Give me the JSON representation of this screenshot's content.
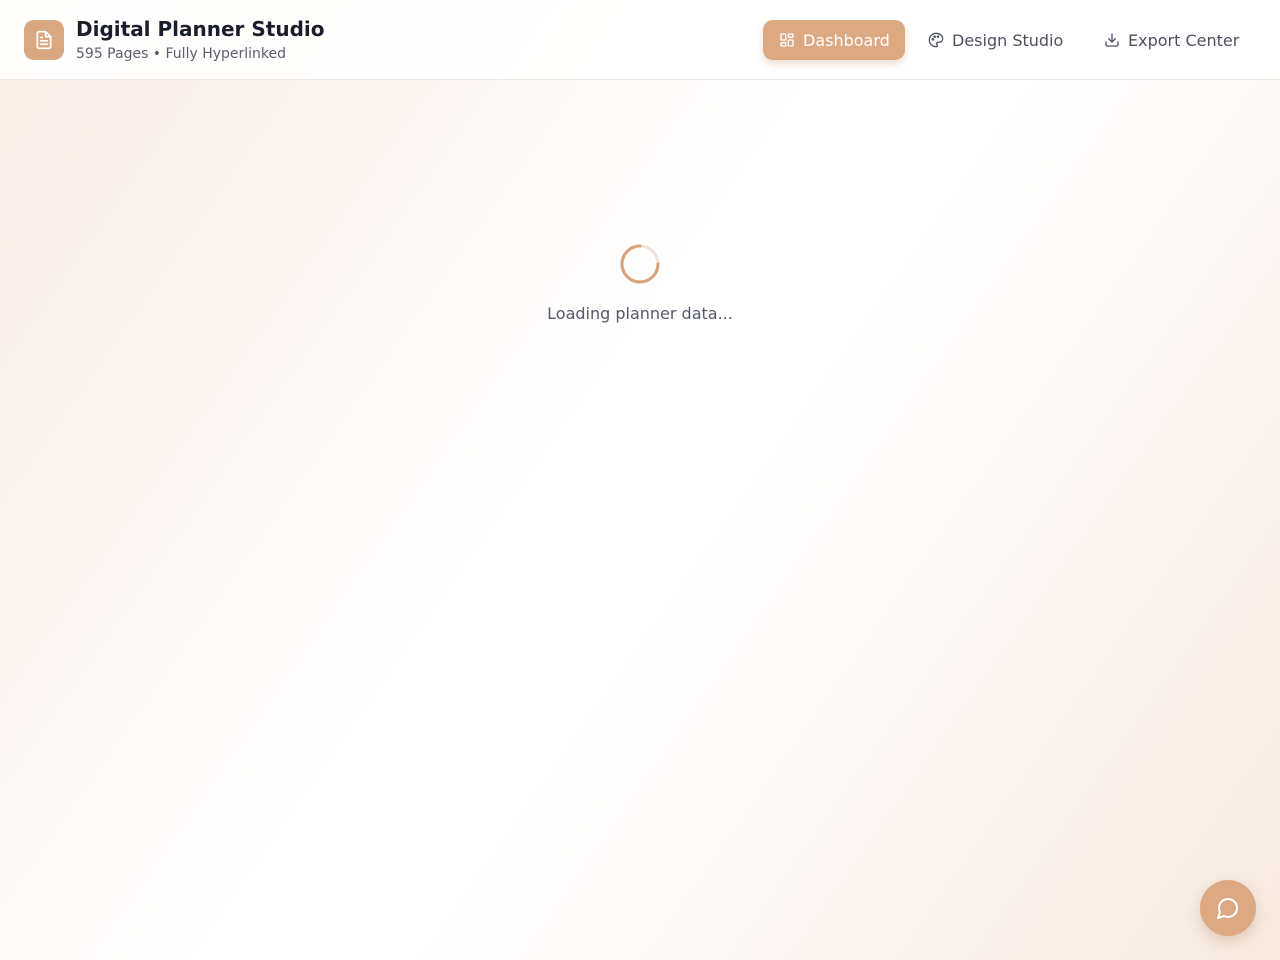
{
  "app": {
    "title": "Digital Planner Studio",
    "subtitle": "595 Pages • Fully Hyperlinked",
    "logo_icon": "document-icon"
  },
  "nav": [
    {
      "label": "Dashboard",
      "icon": "grid-icon",
      "active": true
    },
    {
      "label": "Design Studio",
      "icon": "palette-icon",
      "active": false
    },
    {
      "label": "Export Center",
      "icon": "download-icon",
      "active": false
    }
  ],
  "loading": {
    "text": "Loading planner data..."
  },
  "chat": {
    "icon": "chat-bubble-icon"
  },
  "colors": {
    "accent": "#dca983",
    "title_text": "#1a1d2b",
    "muted_text": "#5b6070"
  }
}
